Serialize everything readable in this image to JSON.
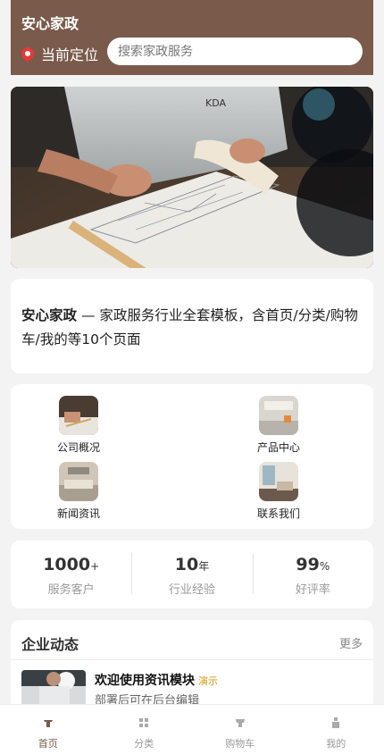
{
  "header": {
    "title": "安心家政",
    "location_label": "当前定位",
    "search_placeholder": "搜索家政服务"
  },
  "intro": {
    "brand": "安心家政",
    "text": " — 家政服务行业全套模板，含首页/分类/购物车/我的等10个页面"
  },
  "grid": [
    {
      "label": "公司概况"
    },
    {
      "label": "产品中心"
    },
    {
      "label": "新闻资讯"
    },
    {
      "label": "联系我们"
    }
  ],
  "stats": [
    {
      "value": "1000",
      "unit": "+",
      "label": "服务客户"
    },
    {
      "value": "10",
      "unit": "年",
      "label": "行业经验"
    },
    {
      "value": "99",
      "unit": "%",
      "label": "好评率"
    }
  ],
  "news": {
    "heading": "企业动态",
    "more": "更多",
    "items": [
      {
        "title": "欢迎使用资讯模块",
        "badge": "演示",
        "subtitle": "部署后可在后台编辑"
      }
    ]
  },
  "tabs": [
    {
      "label": "首页",
      "icon": "home-icon"
    },
    {
      "label": "分类",
      "icon": "category-icon"
    },
    {
      "label": "购物车",
      "icon": "cart-icon"
    },
    {
      "label": "我的",
      "icon": "user-icon"
    }
  ],
  "colors": {
    "brand": "#7a5a4b",
    "pin": "#e53935",
    "badge": "#d49a14"
  }
}
